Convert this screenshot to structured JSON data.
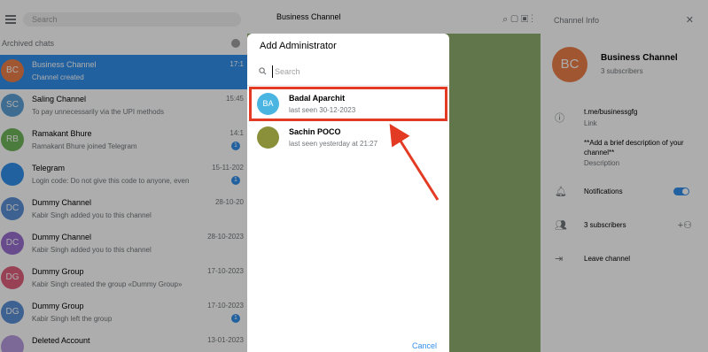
{
  "left_panel": {
    "search_placeholder": "Search",
    "archived_label": "Archived chats",
    "chats": [
      {
        "initials": "BC",
        "color": "#ee7f4a",
        "name": "Business Channel",
        "preview": "Channel created",
        "time": "17:1",
        "active": true,
        "unread": ""
      },
      {
        "initials": "SC",
        "color": "#5ea1d6",
        "name": "Saling Channel",
        "preview": "To pay unnecessarily via the UPI methods",
        "time": "15:45",
        "active": false,
        "unread": ""
      },
      {
        "initials": "RB",
        "color": "#6fb65a",
        "name": "Ramakant Bhure",
        "preview": "Ramakant Bhure joined Telegram",
        "time": "14:1",
        "active": false,
        "unread": "1"
      },
      {
        "initials": "",
        "color": "#3390ec",
        "name": "Telegram",
        "preview": "Login code: Do not give this code to anyone, even",
        "time": "15-11-202",
        "active": false,
        "unread": "1"
      },
      {
        "initials": "DC",
        "color": "#5b8fd6",
        "name": "Dummy Channel",
        "preview": "Kabir Singh added you to this channel",
        "time": "28-10-20",
        "active": false,
        "unread": ""
      },
      {
        "initials": "DC",
        "color": "#9a6fd0",
        "name": "Dummy Channel",
        "preview": "Kabir Singh added you to this channel",
        "time": "28-10-2023",
        "active": false,
        "unread": ""
      },
      {
        "initials": "DG",
        "color": "#e0607e",
        "name": "Dummy Group",
        "preview": "Kabir Singh created the group «Dummy Group»",
        "time": "17-10-2023",
        "active": false,
        "unread": ""
      },
      {
        "initials": "DG",
        "color": "#5b8fd6",
        "name": "Dummy Group",
        "preview": "Kabir Singh left the group",
        "time": "17-10-2023",
        "active": false,
        "unread": "1"
      },
      {
        "initials": "",
        "color": "#b79be0",
        "name": "Deleted Account",
        "preview": "",
        "time": "13-01-2023",
        "active": false,
        "unread": ""
      }
    ]
  },
  "chat_header": {
    "title": "Business Channel"
  },
  "right_panel": {
    "title": "Channel Info",
    "avatar_initials": "BC",
    "channel_name": "Business Channel",
    "subscribers_short": "3 subscribers",
    "link": "t.me/businessgfg",
    "link_label": "Link",
    "description": "**Add a brief description of your channel**",
    "description_label": "Description",
    "notifications_label": "Notifications",
    "subscribers_label": "3 subscribers",
    "leave_label": "Leave channel"
  },
  "modal": {
    "title": "Add Administrator",
    "search_placeholder": "Search",
    "users": [
      {
        "initials": "BA",
        "color": "#4ab5e0",
        "name": "Badal Aparchit",
        "status": "last seen 30-12-2023"
      },
      {
        "initials": "",
        "color": "#8a8f3a",
        "name": "Sachin POCO",
        "status": "last seen yesterday at 21:27"
      }
    ],
    "cancel_label": "Cancel"
  },
  "colors": {
    "accent": "#3390ec",
    "annotation": "#e33b23",
    "chat_bg": "#8fae6d"
  }
}
